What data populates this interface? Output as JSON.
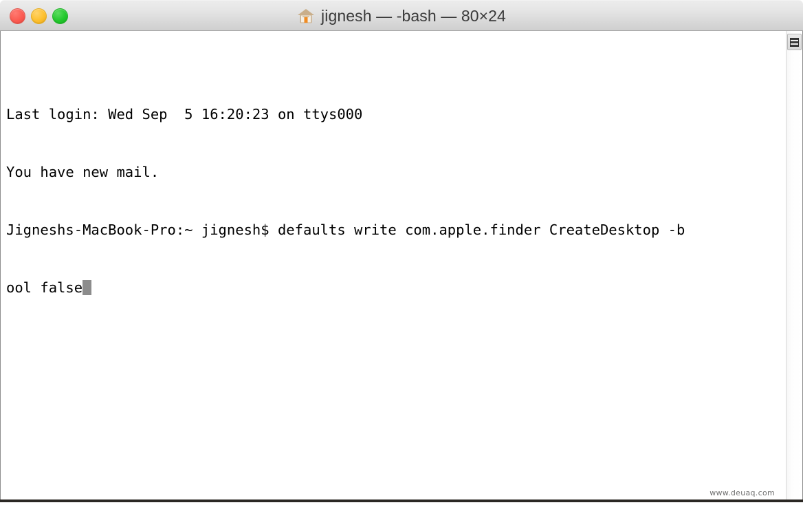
{
  "window": {
    "title": "jignesh — -bash — 80×24",
    "title_icon": "home-icon",
    "controls": {
      "close_label": "",
      "minimize_label": "",
      "zoom_label": ""
    },
    "colors": {
      "close": "#fb5b51",
      "minimize": "#fdc02e",
      "zoom": "#23c82d",
      "titlebar_top": "#ececec",
      "titlebar_bottom": "#cfcfcf",
      "terminal_background": "#ffffff",
      "terminal_foreground": "#000000",
      "cursor": "#8c8c8c"
    }
  },
  "terminal": {
    "columns": 80,
    "rows": 24,
    "lines": [
      "Last login: Wed Sep  5 16:20:23 on ttys000",
      "You have new mail.",
      "Jigneshs-MacBook-Pro:~ jignesh$ defaults write com.apple.finder CreateDesktop -b",
      "ool false"
    ],
    "cursor_glyph": "block-cursor"
  },
  "scrollbar": {
    "thumb_icon": "scroll-thumb-icon"
  },
  "watermark": {
    "text": "www.deuaq.com"
  }
}
